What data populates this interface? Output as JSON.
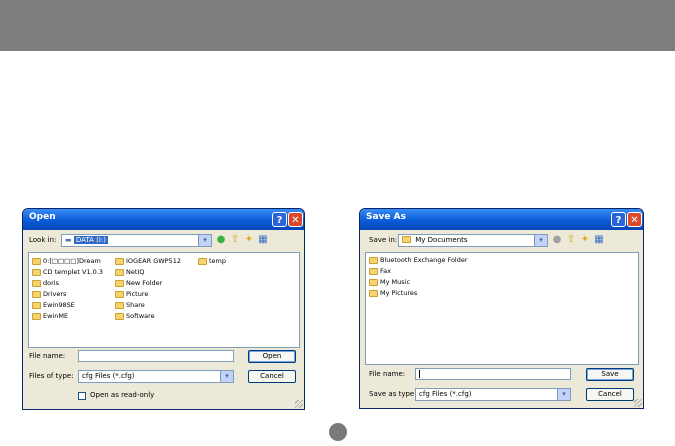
{
  "open_dialog": {
    "title": "Open",
    "help_glyph": "?",
    "close_glyph": "✕",
    "look_in_label": "Look in:",
    "look_in_value": "DATA (I:)",
    "folders": [
      "0:[□□□□]Dream",
      "CD templet V1.0.3",
      "doris",
      "Drivers",
      "Ewin98SE",
      "EwinME",
      "IOGEAR GWP512",
      "NetIQ",
      "New Folder",
      "Picture",
      "Share",
      "Software",
      "temp"
    ],
    "file_name_label": "File name:",
    "file_name_value": "",
    "files_of_type_label": "Files of type:",
    "files_of_type_value": "cfg Files (*.cfg)",
    "open_button": "Open",
    "cancel_button": "Cancel",
    "read_only_label": "Open as read-only"
  },
  "save_dialog": {
    "title": "Save As",
    "help_glyph": "?",
    "close_glyph": "✕",
    "save_in_label": "Save in:",
    "save_in_value": "My Documents",
    "folders": [
      "Bluetooth Exchange Folder",
      "Fax",
      "My Music",
      "My Pictures"
    ],
    "file_name_label": "File name:",
    "file_name_value": "",
    "save_as_type_label": "Save as type:",
    "save_as_type_value": "cfg Files (*.cfg)",
    "save_button": "Save",
    "cancel_button": "Cancel"
  },
  "icons": {
    "combo_arrow": "▾",
    "back": "●",
    "up": "⇧",
    "new_folder": "✦",
    "views": "▦"
  },
  "colors": {
    "titlebar": "#0a5bd8",
    "dialog_bg": "#ece9d8",
    "top_band": "#7d7d7d",
    "selection": "#316ac5"
  }
}
